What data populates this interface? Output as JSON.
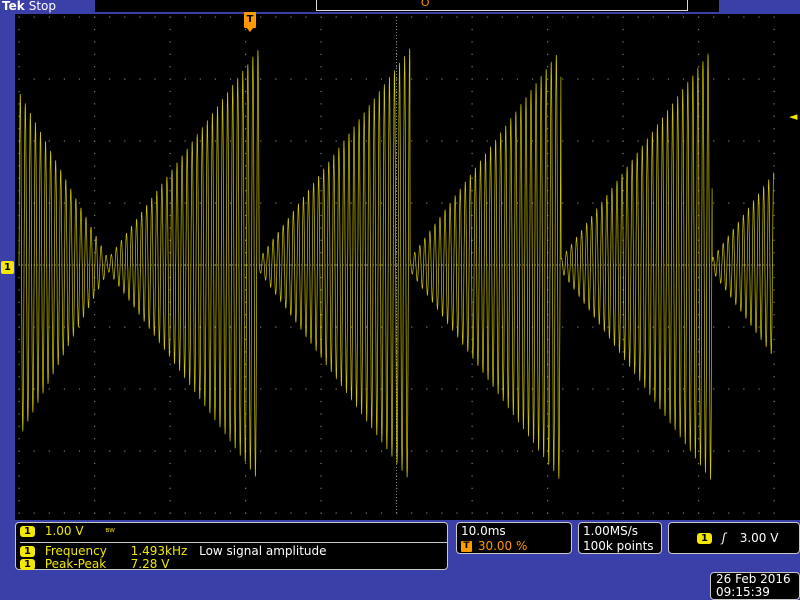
{
  "header": {
    "brand": "Tek",
    "status": "Stop"
  },
  "markers": {
    "trigger_position_glyph": "T",
    "channel_glyph": "1",
    "trigger_level_glyph": "◄",
    "record_marker_glyph": "Ʊ"
  },
  "channel": {
    "number": "1",
    "scale": "1.00 V",
    "bandwidth_icon": "bandwidth-limit-icon",
    "bandwidth_glyph": "ᴮᵂ"
  },
  "measurements": [
    {
      "channel": "1",
      "name": "Frequency",
      "value": "1.493kHz",
      "note": "Low signal amplitude"
    },
    {
      "channel": "1",
      "name": "Peak-Peak",
      "value": "7.28 V",
      "note": ""
    }
  ],
  "horizontal": {
    "time_per_div": "10.0ms",
    "trigger_glyph": "T",
    "trigger_position": "30.00 %"
  },
  "acquisition": {
    "sample_rate": "1.00MS/s",
    "record_length": "100k points"
  },
  "trigger": {
    "channel": "1",
    "slope_glyph": "ʃ",
    "level": "3.00 V"
  },
  "datetime": {
    "date": "26 Feb  2016",
    "time": "09:15:39"
  },
  "colors": {
    "trace": "#f3e800",
    "frame": "#3b40a8",
    "screen": "#000000",
    "trigger_accent": "#ff9a00"
  },
  "waveform": {
    "description": "triangular amplitude-modulated burst",
    "segments": [
      {
        "start_ms": 0.0,
        "end_ms": 11.8,
        "amp_start": 2.8,
        "amp_end": 0.1
      },
      {
        "start_ms": 11.8,
        "end_ms": 31.8,
        "amp_start": 0.1,
        "amp_end": 3.5
      },
      {
        "start_ms": 31.8,
        "end_ms": 51.8,
        "amp_start": 0.1,
        "amp_end": 3.5
      },
      {
        "start_ms": 51.8,
        "end_ms": 71.8,
        "amp_start": 0.1,
        "amp_end": 3.5
      },
      {
        "start_ms": 71.8,
        "end_ms": 91.8,
        "amp_start": 0.1,
        "amp_end": 3.5
      },
      {
        "start_ms": 91.8,
        "end_ms": 100.0,
        "amp_start": 0.1,
        "amp_end": 1.5
      }
    ],
    "time_span_ms": 100,
    "volts_per_div": 1.0,
    "vertical_divisions": 8,
    "horizontal_divisions": 10
  }
}
